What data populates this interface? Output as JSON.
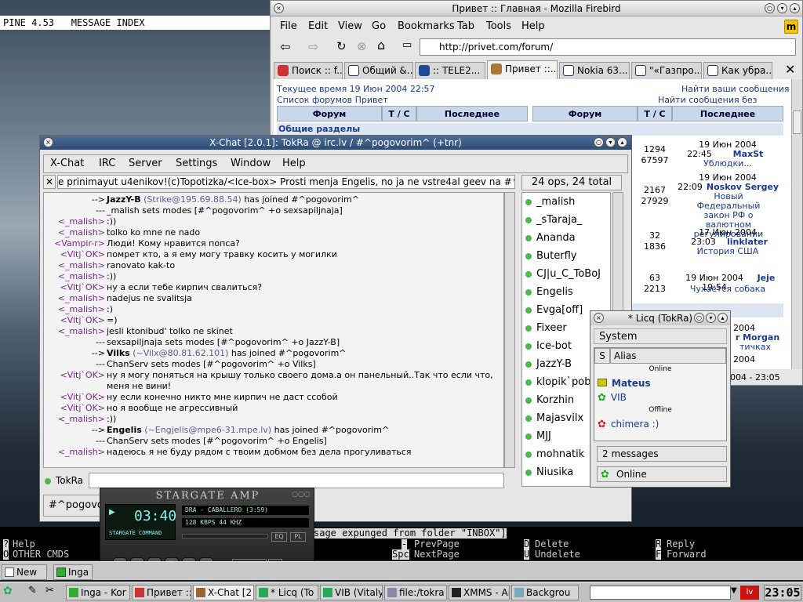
{
  "terminal": {
    "title": "PINE 4.53   MESSAGE INDEX",
    "expunged": "sage expunged from folder \"INBOX\"]",
    "keys": [
      {
        "k": "?",
        "t": "Help"
      },
      {
        "k": "O",
        "t": "OTHER CMDS"
      },
      {
        "k": "-",
        "t": "PrevPage"
      },
      {
        "k": "Spc",
        "t": "NextPage"
      },
      {
        "k": "D",
        "t": "Delete"
      },
      {
        "k": "U",
        "t": "Undelete"
      },
      {
        "k": "R",
        "t": "Reply"
      },
      {
        "k": "F",
        "t": "Forward"
      }
    ]
  },
  "firebird": {
    "title": "Привет :: Главная - Mozilla Firebird",
    "menu": [
      "File",
      "Edit",
      "View",
      "Go",
      "Bookmarks",
      "Tab",
      "Tools",
      "Help"
    ],
    "url": "http://privet.com/forum/",
    "tabs": [
      "Поиск :: f...",
      "Общий &...",
      ":: TELE2...",
      "Привет ::...",
      "Nokia 63...",
      "\"«Газпро...",
      "Как убра..."
    ],
    "content": {
      "time": "Текущее время 19 Июн 2004 22:57",
      "forum_list": "Список форумов Привет",
      "find_yours": "Найти ваши сообщения",
      "find_unanswered": "Найти сообщения без ответов",
      "col_forum": "Форум",
      "col_tc": "Т / С",
      "col_last": "Последнее сообщение",
      "section": "Общие разделы",
      "rows": [
        {
          "t": "1294",
          "c": "67597",
          "d": "19 Июн 2004",
          "h": "22:45",
          "u": "MaxSt",
          "s": "Ублюдки..."
        },
        {
          "t": "2167",
          "c": "27929",
          "d": "19 Июн 2004",
          "h": "22:09",
          "u": "Noskov Sergey",
          "s": "Новый Федеральный закон РФ о валютном регулировании"
        },
        {
          "t": "32",
          "c": "1836",
          "d": "17 Июн 2004",
          "h": "23:03",
          "u": "linklater",
          "s": "История США"
        },
        {
          "t": "63",
          "c": "2213",
          "d": "19 Июн 2004 19:54",
          "h": "",
          "u": "Jeje",
          "s": "Чухается собака"
        }
      ],
      "partial1": "2004",
      "partial2": "r Morgan",
      "partial3": "тичках",
      "partial4": "2004",
      "partial5": "004 - 23:05"
    }
  },
  "xchat": {
    "title": "X-Chat [2.0.1]: TokRa @ irc.lv / #^pogovorim^ (+tnr)",
    "menu": [
      "X-Chat",
      "IRC",
      "Server",
      "Settings",
      "Window",
      "Help"
    ],
    "topic": "e prinimayut u4enikov!(c)Topotizka/<Ice-box> Prosti menja Engelis, no ja ne vstre4al geev na #^pogovorim^",
    "count": "24 ops, 24 total",
    "lines": [
      {
        "n": "-->",
        "m": "JazzY-B",
        "b": true,
        "x": " (Strike@195.69.88.54)",
        "y": " has joined #^pogovorim^"
      },
      {
        "n": "---",
        "m": "_malish sets modes [#^pogovorim^ +o sexsapiljnaja]"
      },
      {
        "n": "<_malish>",
        "m": ":))"
      },
      {
        "n": "<_malish>",
        "m": "tolko ko mne ne nado"
      },
      {
        "n": "<Vampir-r>",
        "m": "Люди! Кому нравится попса?"
      },
      {
        "n": "<Vitj`OK>",
        "m": "помрет кто, а я ему могу травку косить у могилки"
      },
      {
        "n": "<_malish>",
        "m": "ranovato kak-to"
      },
      {
        "n": "<_malish>",
        "m": ":))"
      },
      {
        "n": "<Vitj`OK>",
        "m": "ну а если тебе кирпич свалиться?"
      },
      {
        "n": "<_malish>",
        "m": "nadejus ne svalitsja"
      },
      {
        "n": "<_malish>",
        "m": ":)"
      },
      {
        "n": "<Vitj`OK>",
        "m": "=)"
      },
      {
        "n": "<_malish>",
        "m": "jesli ktonibud' tolko ne skinet"
      },
      {
        "n": "---",
        "m": "sexsapiljnaja sets modes [#^pogovorim^ +o JazzY-B]"
      },
      {
        "n": "-->",
        "m": "Vilks",
        "b": true,
        "x": " (~Vilx@80.81.62.101)",
        "y": " has joined #^pogovorim^"
      },
      {
        "n": "---",
        "m": "ChanServ sets modes [#^pogovorim^ +o Vilks]"
      },
      {
        "n": "<Vitj`OK>",
        "m": "ну я могу поняться на крышу только своего дома.а он панельный..Так что если что,"
      },
      {
        "n": "",
        "m": "меня не вини!"
      },
      {
        "n": "<Vitj`OK>",
        "m": "ну если конечно никто мне кирпич не даст ссобой"
      },
      {
        "n": "<Vitj`OK>",
        "m": "но я вообще не агрессивный"
      },
      {
        "n": "<_malish>",
        "m": ":))"
      },
      {
        "n": "-->",
        "m": "Engelis",
        "b": true,
        "x": " (~Engjelis@mpe6-31.mpe.lv)",
        "y": " has joined #^pogovorim^"
      },
      {
        "n": "---",
        "m": "ChanServ sets modes [#^pogovorim^ +o Engelis]"
      },
      {
        "n": "<_malish>",
        "m": "надеюсь я не буду рядом с твоим добмом без дела прогуливаться"
      }
    ],
    "users": [
      "_malish",
      "_sTaraja_",
      "Ananda",
      "Buterfly",
      "CJ|u_C_ToBoJ",
      "Engelis",
      "Evga[off]",
      "Fixeer",
      "Ice-bot",
      "JazzY-B",
      "klopik`pobe",
      "Korzhin",
      "Majasvilx",
      "MJJ",
      "mohnatik",
      "Niusika"
    ],
    "nick": "TokRa",
    "channel": "#^pogovorim^"
  },
  "licq": {
    "title": "* Licq (TokRa)",
    "system": "System",
    "col_s": "S",
    "col_alias": "Alias",
    "online": "Online",
    "offline": "Offline",
    "contacts_on": [
      "Mateus",
      "VIB"
    ],
    "contacts_off": [
      "chimera :)"
    ],
    "messages": "2 messages",
    "status": "Online"
  },
  "xmms": {
    "title": "STARGATE AMP",
    "time": "03:40",
    "song": "DRA - CABALLERO (3:59)",
    "rate": "128 KBPS  44 KHZ",
    "brand": "STARGATE COMMAND",
    "shuffle": "SHUFFLE",
    "eq": "EQ",
    "pl": "PL"
  },
  "taskbar_top": {
    "new": "New",
    "inga": "Inga"
  },
  "taskbar": {
    "items": [
      "Inga - Kor",
      "Привет ::",
      "X-Chat [2",
      "* Licq (To",
      "VIB (Vitaly",
      "file:/tokra",
      "XMMS - Ar",
      "Backgrou"
    ],
    "lang": "lv",
    "clock": "23:05"
  }
}
